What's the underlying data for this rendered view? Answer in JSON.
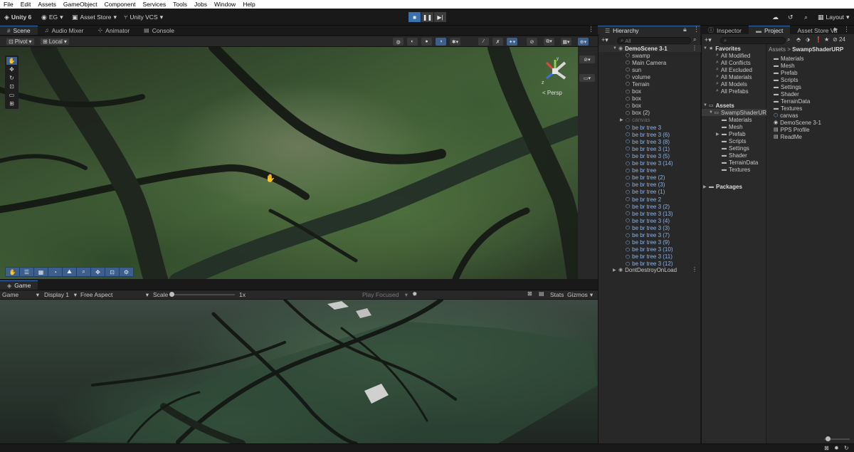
{
  "menu": [
    "File",
    "Edit",
    "Assets",
    "GameObject",
    "Component",
    "Services",
    "Tools",
    "Jobs",
    "Window",
    "Help"
  ],
  "toolbar": {
    "unity_label": "Unity 6",
    "account": "EG",
    "asset_store": "Asset Store",
    "vcs": "Unity VCS",
    "layout": "Layout"
  },
  "scene_tabs": [
    "Scene",
    "Audio Mixer",
    "Animator",
    "Console"
  ],
  "scene_toolbar": {
    "pivot": "Pivot",
    "local": "Local"
  },
  "scene": {
    "persp": "< Persp",
    "gizmo_y": "y",
    "gizmo_z": "z"
  },
  "game_tab": "Game",
  "game_toolbar": {
    "mode": "Game",
    "display": "Display 1",
    "aspect": "Free Aspect",
    "scale_label": "Scale",
    "scale_value": "1x",
    "play_focused": "Play Focused",
    "stats": "Stats",
    "gizmos": "Gizmos"
  },
  "hierarchy": {
    "tab": "Hierarchy",
    "search_placeholder": "All",
    "scene_name": "DemoScene 3-1",
    "items": [
      "swamp",
      "Main Camera",
      "sun",
      "volume",
      "Terrain",
      "box",
      "box",
      "box",
      "box (2)",
      "canvas",
      "be br tree 3",
      "be br tree 3 (6)",
      "be br tree 3 (8)",
      "be br tree 3 (1)",
      "be br tree 3 (5)",
      "be br tree 3 (14)",
      "be br tree",
      "be br tree (2)",
      "be br tree (3)",
      "be br tree (1)",
      "be br tree 2",
      "be br tree 3 (2)",
      "be br tree 3 (13)",
      "be br tree 3 (4)",
      "be br tree 3 (3)",
      "be br tree 3 (7)",
      "be br tree 3 (9)",
      "be br tree 3 (10)",
      "be br tree 3 (11)",
      "be br tree 3 (12)"
    ],
    "dont_destroy": "DontDestroyOnLoad"
  },
  "project": {
    "tabs": [
      "Inspector",
      "Project",
      "Asset Store Va"
    ],
    "count": "24",
    "favorites_label": "Favorites",
    "favorites": [
      "All Modified",
      "All Conflicts",
      "All Excluded",
      "All Materials",
      "All Models",
      "All Prefabs"
    ],
    "assets_label": "Assets",
    "swamp_folder": "SwampShaderURP",
    "swamp_folder_short": "SwampShaderUR",
    "tree_folders": [
      "Materials",
      "Mesh",
      "Prefab",
      "Scripts",
      "Settings",
      "Shader",
      "TerrainData",
      "Textures"
    ],
    "packages_label": "Packages",
    "breadcrumb_root": "Assets",
    "breadcrumb_sep": ">",
    "right_items": [
      "Materials",
      "Mesh",
      "Prefab",
      "Scripts",
      "Settings",
      "Shader",
      "TerrainData",
      "Textures",
      "canvas",
      "DemoScene 3-1",
      "PPS Profile",
      "ReadMe"
    ]
  }
}
